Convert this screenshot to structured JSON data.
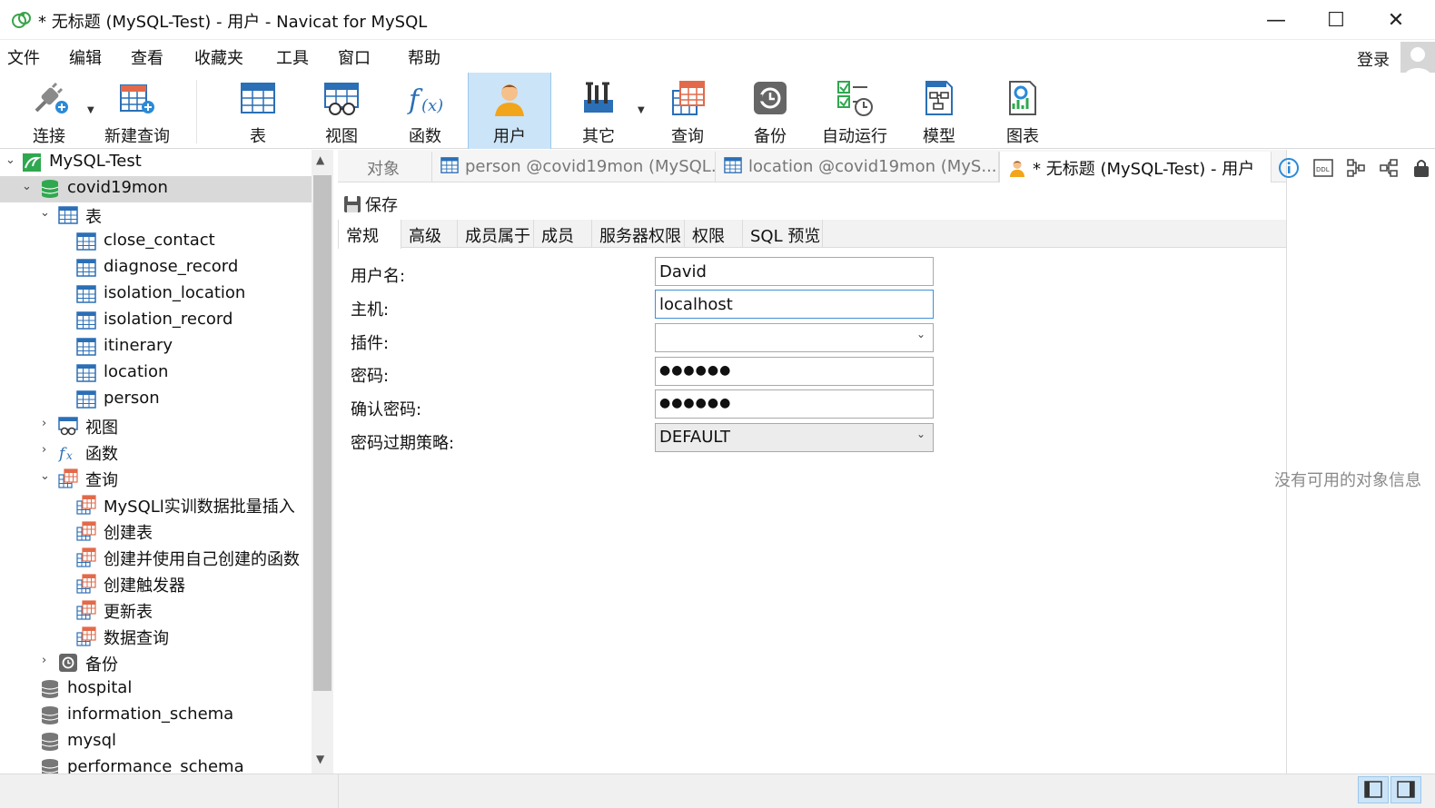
{
  "window": {
    "title": "* 无标题 (MySQL-Test) - 用户 - Navicat for MySQL",
    "minimize_glyph": "—",
    "maximize_glyph": "☐",
    "close_glyph": "✕"
  },
  "menu": {
    "items": [
      "文件",
      "编辑",
      "查看",
      "收藏夹",
      "工具",
      "窗口",
      "帮助"
    ],
    "login": "登录"
  },
  "toolbar": {
    "items": [
      {
        "label": "连接",
        "icon": "connection-plug-icon"
      },
      {
        "label": "新建查询",
        "icon": "new-query-icon"
      },
      {
        "label": "表",
        "icon": "table-icon"
      },
      {
        "label": "视图",
        "icon": "view-icon"
      },
      {
        "label": "函数",
        "icon": "function-icon"
      },
      {
        "label": "用户",
        "icon": "user-icon"
      },
      {
        "label": "其它",
        "icon": "tools-icon"
      },
      {
        "label": "查询",
        "icon": "query-icon"
      },
      {
        "label": "备份",
        "icon": "backup-icon"
      },
      {
        "label": "自动运行",
        "icon": "automation-icon"
      },
      {
        "label": "模型",
        "icon": "model-icon"
      },
      {
        "label": "图表",
        "icon": "chart-icon"
      }
    ],
    "active": "用户"
  },
  "nav": {
    "connection": "MySQL-Test",
    "database": "covid19mon",
    "tables_label": "表",
    "tables": [
      "close_contact",
      "diagnose_record",
      "isolation_location",
      "isolation_record",
      "itinerary",
      "location",
      "person"
    ],
    "views_label": "视图",
    "functions_label": "函数",
    "queries_label": "查询",
    "queries": [
      "MySQLl实训数据批量插入",
      "创建表",
      "创建并使用自己创建的函数",
      "创建触发器",
      "更新表",
      "数据查询"
    ],
    "backup_label": "备份",
    "other_databases": [
      "hospital",
      "information_schema",
      "mysql",
      "performance_schema"
    ]
  },
  "doc_tabs": {
    "objects": "对象",
    "tab1": "person @covid19mon (MySQL...",
    "tab2": "location @covid19mon (MyS...",
    "tab3": "* 无标题 (MySQL-Test) - 用户"
  },
  "editor": {
    "save_label": "保存",
    "tabs": [
      "常规",
      "高级",
      "成员属于",
      "成员",
      "服务器权限",
      "权限",
      "SQL 预览"
    ],
    "active_tab": "常规",
    "fields": {
      "username_label": "用户名:",
      "username_value": "David",
      "host_label": "主机:",
      "host_value": "localhost",
      "plugin_label": "插件:",
      "plugin_value": "",
      "password_label": "密码:",
      "password_mask": "●●●●●●",
      "confirm_label": "确认密码:",
      "confirm_mask": "●●●●●●",
      "expiry_label": "密码过期策略:",
      "expiry_value": "DEFAULT"
    }
  },
  "info_pane": {
    "empty_text": "没有可用的对象信息"
  },
  "colors": {
    "active_tool_bg": "#cce4f7",
    "selected_row_bg": "#d9d9d9",
    "focus_border": "#3f8fd8",
    "db_green": "#2fa84f",
    "table_blue": "#2b6fb6"
  }
}
